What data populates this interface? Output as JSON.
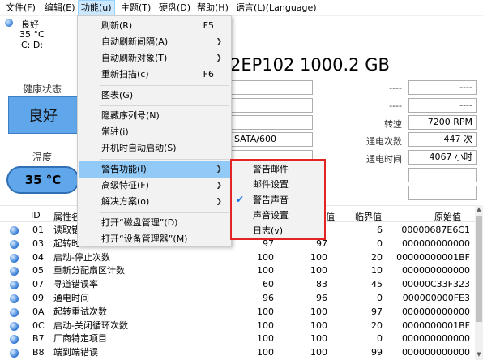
{
  "menubar": [
    "文件(F)",
    "编辑(E)",
    "功能(u)",
    "主题(T)",
    "硬盘(D)",
    "帮助(H)",
    "语言(L)(Language)"
  ],
  "disk_strip": {
    "status": "良好",
    "temp": "35 °C",
    "drives": "C: D:"
  },
  "left": {
    "health_label": "健康状态",
    "health_value": "良好",
    "temp_label": "温度",
    "temp_value": "35 °C"
  },
  "model": "2EP102 1000.2 GB",
  "fields": {
    "interface": "SATA/600",
    "dash1": "----",
    "dash1b": "----",
    "dash2": "----",
    "dash2b": "----",
    "rotation_label": "转速",
    "rotation_value": "7200 RPM",
    "power_count_label": "通电次数",
    "power_count_value": "447 次",
    "power_time_label": "通电时间",
    "power_time_value": "4067 小时"
  },
  "table": {
    "headers": [
      "ID",
      "属性名",
      "值",
      "临界值",
      "原始值"
    ],
    "rows": [
      [
        "01",
        "读取错",
        "",
        "6",
        "00000687E6C1"
      ],
      [
        "03",
        "起转时",
        "97",
        "0",
        "000000000000"
      ],
      [
        "04",
        "启动-停止次数",
        "100",
        "20",
        "00000000001BF"
      ],
      [
        "05",
        "重新分配扇区计数",
        "100",
        "10",
        "000000000000"
      ],
      [
        "07",
        "寻道错误率",
        "83",
        "45",
        "00000C33F323"
      ],
      [
        "09",
        "通电时间",
        "96",
        "0",
        "000000000FE3"
      ],
      [
        "0A",
        "起转重试次数",
        "100",
        "97",
        "000000000000"
      ],
      [
        "0C",
        "启动-关闭循环次数",
        "100",
        "20",
        "0000000001BF"
      ],
      [
        "B7",
        "厂商特定项目",
        "100",
        "0",
        "000000000000"
      ],
      [
        "B8",
        "端到端错误",
        "100",
        "99",
        "000000000000"
      ]
    ],
    "col_cur": [
      "",
      "97",
      "100",
      "100",
      "60",
      "96",
      "100",
      "100",
      "100",
      "100"
    ]
  },
  "menu": {
    "items": [
      {
        "label": "刷新(R)",
        "shortcut": "F5"
      },
      {
        "label": "自动刷新间隔(A)",
        "arrow": true
      },
      {
        "label": "自动刷新对象(T)",
        "arrow": true
      },
      {
        "label": "重新扫描(c)",
        "shortcut": "F6"
      },
      {
        "label": "图表(G)"
      },
      {
        "label": "隐藏序列号(N)"
      },
      {
        "label": "常驻(i)"
      },
      {
        "label": "开机时自动启动(S)"
      },
      {
        "label": "警告功能(I)",
        "arrow": true
      },
      {
        "label": "高级特征(F)",
        "arrow": true
      },
      {
        "label": "解决方案(o)",
        "arrow": true
      },
      {
        "label": "打开“磁盘管理”(D)"
      },
      {
        "label": "打开“设备管理器”(M)"
      }
    ]
  },
  "submenu": {
    "items": [
      "警告邮件",
      "邮件设置",
      "警告声音",
      "声音设置",
      "日志(v)"
    ],
    "checked_index": 2
  },
  "colors": {
    "accent": "#5fa6ea",
    "menu_highlight": "#91c9f7",
    "submenu_border": "#e32424"
  }
}
